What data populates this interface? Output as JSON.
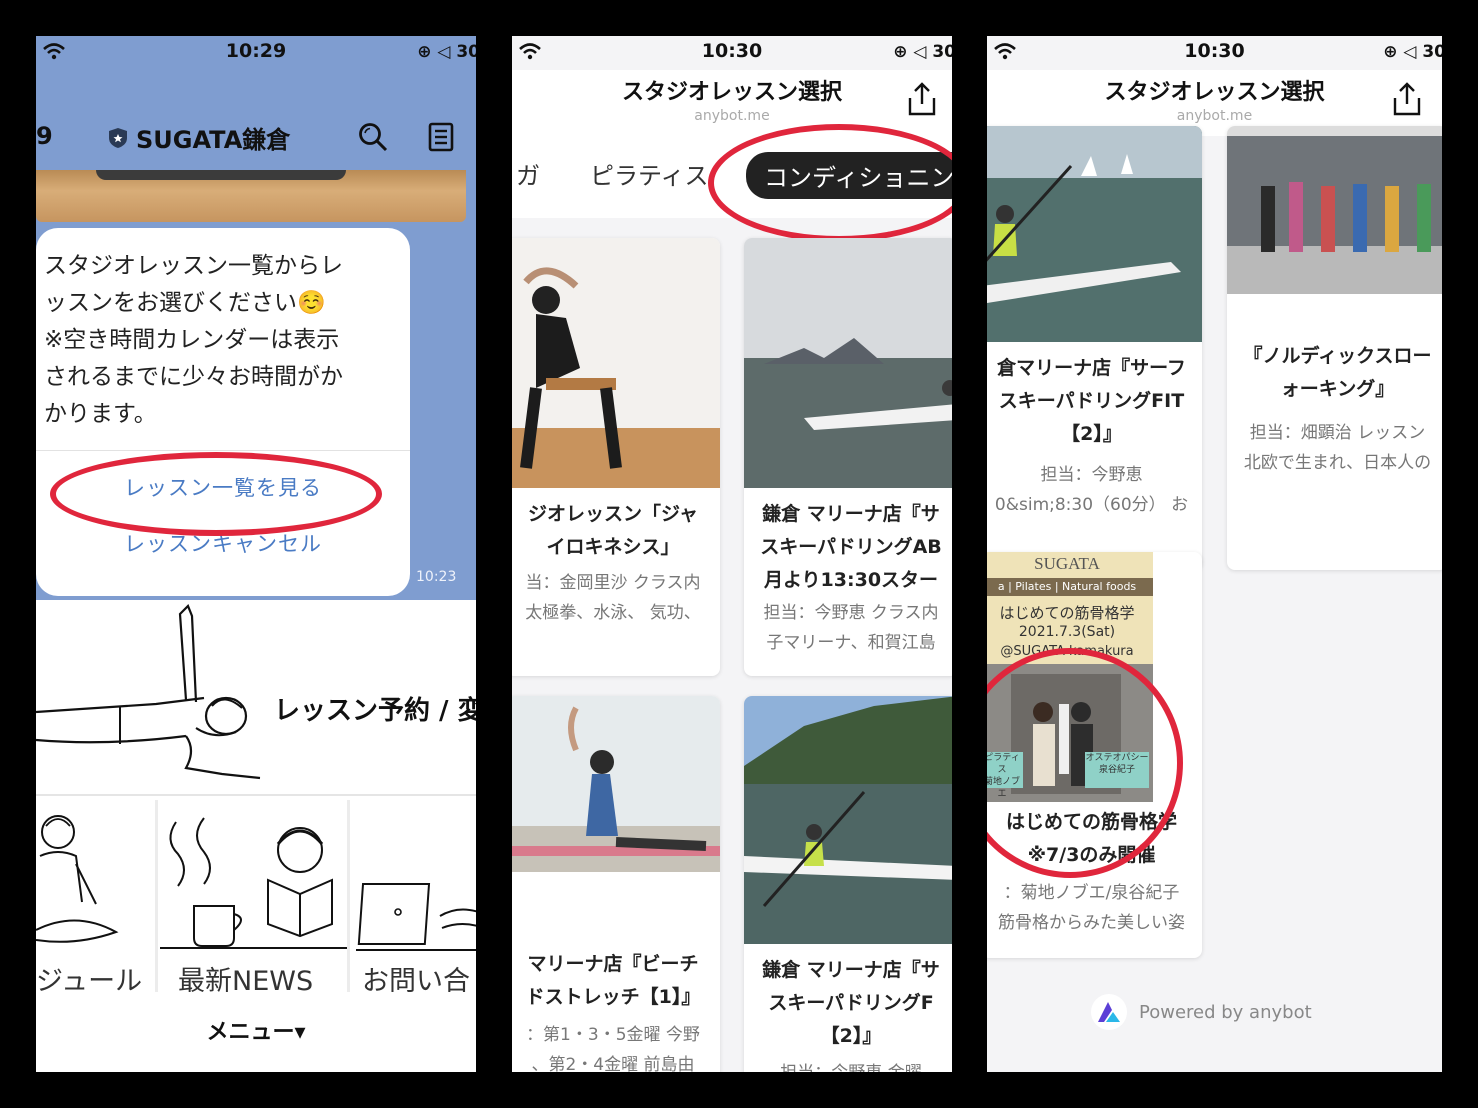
{
  "screen1": {
    "status_time": "10:29",
    "status_right": "⊕ ◁ 30",
    "header_back_count": "9",
    "header_title": "SUGATA鎌倉",
    "message": "スタジオレッスン一覧からレ\nッスンをお選びください☺️\n※空き時間カレンダーは表示\nされるまでに少々お時間がか\nかります。",
    "button_view_lessons": "レッスン一覧を見る",
    "button_cancel": "レッスンキャンセル",
    "message_time": "10:23",
    "richmenu_main_label": "レッスン予約 / 変",
    "richmenu_schedule": "ジュール",
    "richmenu_news": "最新NEWS",
    "richmenu_contact": "お問い合",
    "richmenu_toggle": "メニュー▾"
  },
  "screen2": {
    "status_time": "10:30",
    "status_right": "⊕ ◁ 30",
    "title": "スタジオレッスン選択",
    "subtitle": "anybot.me",
    "tabs": [
      "ガ",
      "ピラティス",
      "コンディショニン"
    ],
    "cards": [
      {
        "title": "ジオレッスン「ジャ\nイロキネシス」",
        "desc": "当：金岡里沙 クラス内\n太極拳、水泳、 気功、"
      },
      {
        "title": "鎌倉 マリーナ店『サ\nスキーパドリングAB\n月より13:30スター",
        "desc": "担当：今野恵 クラス内\n子マリーナ、和賀江島"
      },
      {
        "title": "マリーナ店『ビーチ\nドストレッチ【1】』",
        "desc": "：第1・3・5金曜 今野\n、第2・4金曜 前島由"
      },
      {
        "title": "鎌倉 マリーナ店『サ\nスキーパドリングF\n【2】』",
        "desc": "担当：今野恵 金曜"
      }
    ]
  },
  "screen3": {
    "status_time": "10:30",
    "status_right": "⊕ ◁ 30",
    "title": "スタジオレッスン選択",
    "subtitle": "anybot.me",
    "cards": [
      {
        "title": "倉マリーナ店『サーフ\nスキーパドリングFIT\n【2】』",
        "desc": "担当：今野恵\n0&sim;8:30（60分） お"
      },
      {
        "title": "『ノルディックスロー\nォーキング』",
        "desc": "担当：畑顕治 レッスン\n北欧で生まれ、日本人の"
      },
      {
        "title": "はじめての筋骨格学\n※7/3のみ開催",
        "desc": "：菊地ノブエ/泉谷紀子\n筋骨格からみた美しい姿"
      }
    ],
    "poster_brand": "SUGATA",
    "poster_tagline": "a | Pilates | Natural foods",
    "poster_heading": "はじめての筋骨格学",
    "poster_date": "2021.7.3(Sat)",
    "poster_venue": "@SUGATA kamakura",
    "poster_left_tag": "ピラティス\n菊地ノブエ",
    "poster_right_tag": "オステオパシー\n泉谷紀子",
    "powered_by": "Powered by anybot"
  },
  "colors": {
    "line_bg": "#7f9dd0",
    "link_blue": "#4a7bc4",
    "highlight_red": "#e0263c",
    "active_tab": "#222222"
  }
}
